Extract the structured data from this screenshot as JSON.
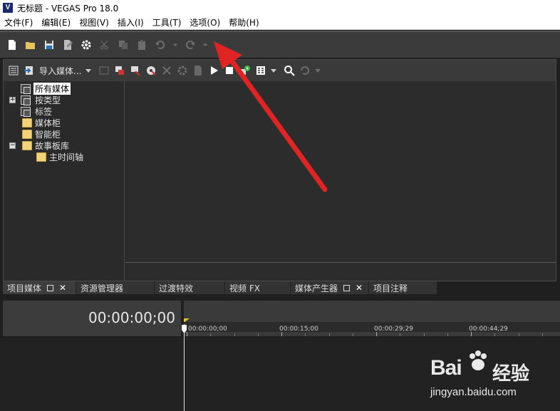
{
  "window": {
    "title": "无标题 - VEGAS Pro 18.0",
    "app_icon_letter": "V"
  },
  "menu": [
    "文件(F)",
    "编辑(E)",
    "视图(V)",
    "插入(I)",
    "工具(T)",
    "选项(O)",
    "帮助(H)"
  ],
  "toolbar": {
    "icons": [
      "new-file-icon",
      "open-folder-icon",
      "save-icon",
      "save-as-icon",
      "properties-gear-icon",
      "cut-icon",
      "copy-icon",
      "paste-icon",
      "undo-icon",
      "undo-dropdown-icon",
      "redo-icon",
      "redo-dropdown-icon"
    ]
  },
  "media_toolbar": {
    "import_label": "导入媒体..."
  },
  "tree": {
    "items": [
      {
        "label": "所有媒体",
        "selected": true,
        "expander": ""
      },
      {
        "label": "按类型",
        "expander": "+"
      },
      {
        "label": "标签",
        "expander": ""
      },
      {
        "label": "媒体柜",
        "expander": ""
      },
      {
        "label": "智能柜",
        "expander": ""
      },
      {
        "label": "故事板库",
        "expander": "−"
      },
      {
        "label": "主时间轴",
        "expander": ""
      }
    ]
  },
  "tabs": [
    "项目媒体",
    "资源管理器",
    "过渡特效",
    "视频 FX",
    "媒体产生器",
    "项目注释"
  ],
  "timeline": {
    "timecode": "00:00:00;00",
    "ruler_labels": [
      "00:00:00;00",
      "00:00:15;00",
      "00:00:29;29",
      "00:00:44;29"
    ]
  },
  "colors": {
    "arrow": "#e02424",
    "loop_marker": "#e3c02b"
  },
  "watermark": {
    "brand": "Bai",
    "product": "经验",
    "url": "jingyan.baidu.com"
  }
}
